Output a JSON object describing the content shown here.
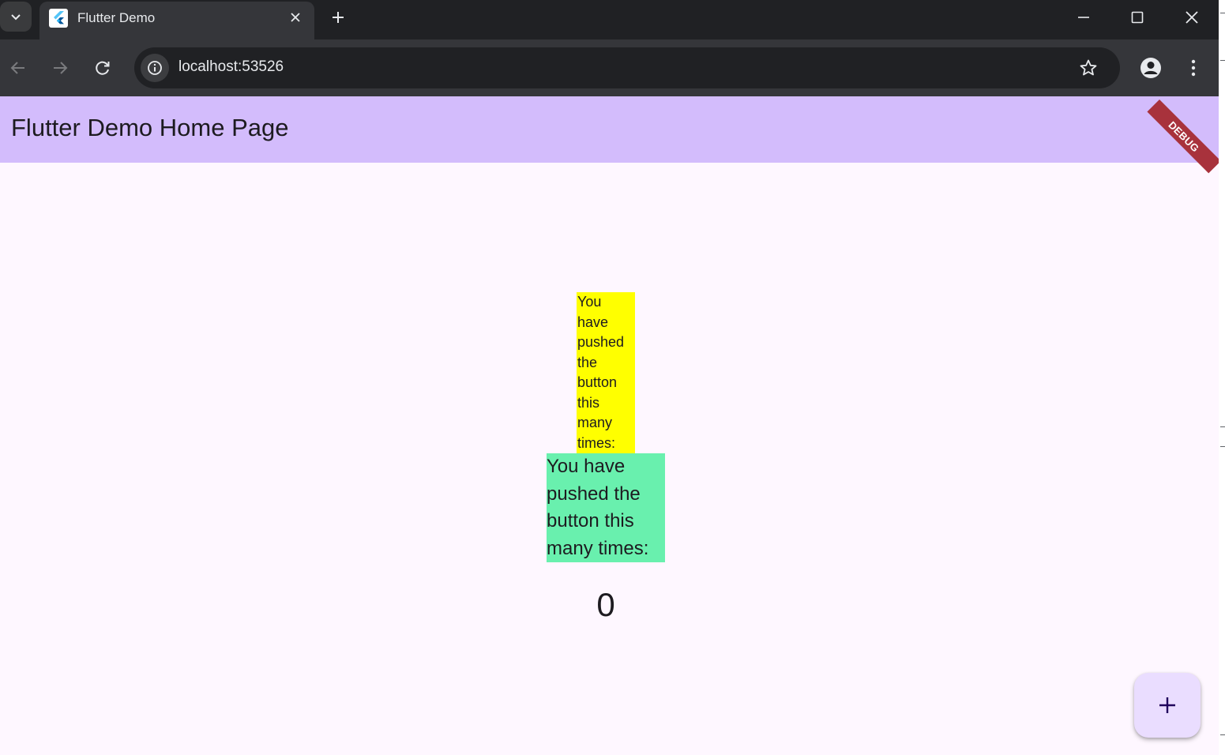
{
  "browser": {
    "tab_title": "Flutter Demo",
    "url": "localhost:53526"
  },
  "icons": {
    "tab_search": "chevron-down-icon",
    "favicon": "flutter-logo-icon",
    "tab_close": "close-icon",
    "new_tab": "plus-icon",
    "minimize": "minimize-icon",
    "maximize": "maximize-icon",
    "close_window": "close-icon",
    "back": "arrow-left-icon",
    "forward": "arrow-right-icon",
    "reload": "reload-icon",
    "site_info": "info-icon",
    "bookmark": "star-icon",
    "profile": "account-icon",
    "menu": "more-vertical-icon",
    "fab": "plus-icon"
  },
  "app": {
    "title": "Flutter Demo Home Page",
    "debug_banner": "DEBUG",
    "message_small": "You have pushed the button this many times:",
    "message_large": "You have pushed the button this many times:",
    "counter": "0"
  },
  "colors": {
    "appbar": "#d3bcfc",
    "page_background": "#fef7ff",
    "yellow_box": "#ffff00",
    "green_box": "#69f0ae",
    "fab": "#eaddff",
    "debug_banner": "#a8323c"
  }
}
